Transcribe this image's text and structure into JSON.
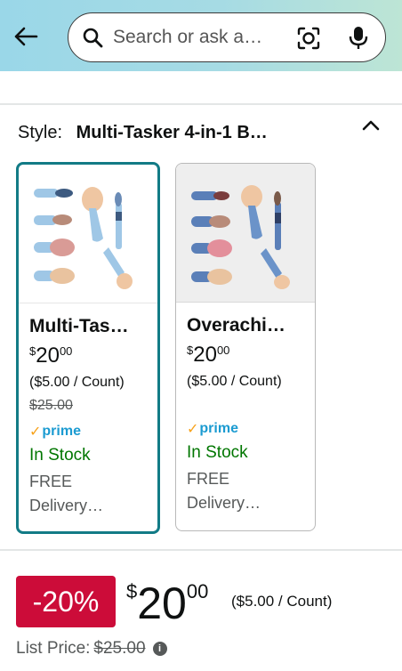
{
  "header": {
    "search_placeholder": "Search or ask a…"
  },
  "style_row": {
    "label": "Style:",
    "value": "Multi-Tasker 4-in-1 B…"
  },
  "cards": [
    {
      "name": "Multi-Tas…",
      "currency": "$",
      "price_whole": "20",
      "price_cents": "00",
      "unit_price": "($5.00 / Count)",
      "old_price": "$25.00",
      "prime_label": "prime",
      "stock": "In Stock",
      "free": "FREE",
      "delivery": "Delivery…",
      "selected": true
    },
    {
      "name": "Overachi…",
      "currency": "$",
      "price_whole": "20",
      "price_cents": "00",
      "unit_price": "($5.00 / Count)",
      "prime_label": "prime",
      "stock": "In Stock",
      "free": "FREE",
      "delivery": "Delivery…",
      "selected": false
    }
  ],
  "price_block": {
    "discount": "-20%",
    "currency": "$",
    "whole": "20",
    "cents": "00",
    "unit_price": "($5.00 / Count)",
    "list_price_label": "List Price:",
    "list_price_value": "$25.00"
  },
  "colors": {
    "accent_teal": "#127b86",
    "deal_red": "#cc0c39",
    "stock_green": "#007600",
    "prime_blue": "#1b9bd1"
  }
}
